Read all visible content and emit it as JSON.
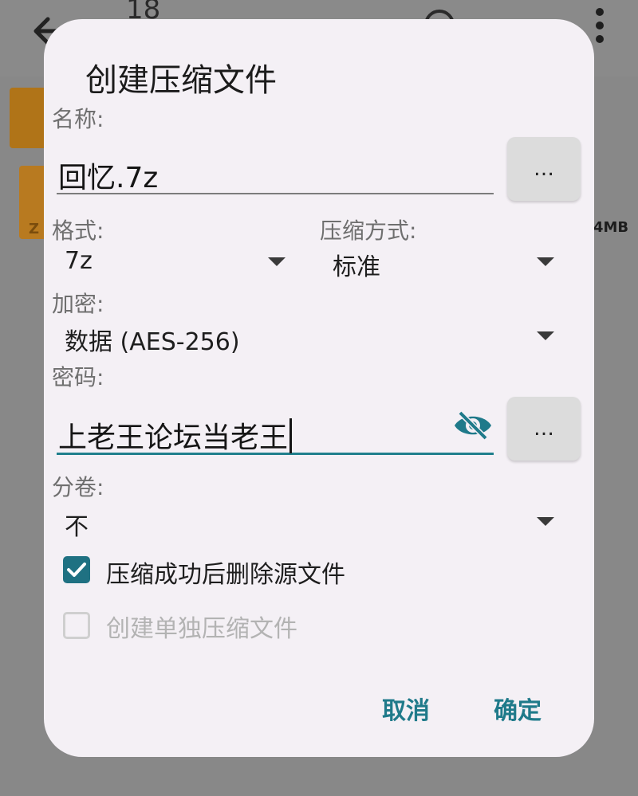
{
  "background": {
    "count_label": "18",
    "file_size": "4MB"
  },
  "dialog": {
    "title": "创建压缩文件",
    "name": {
      "label": "名称:",
      "value": "回忆.7z",
      "browse_label": "..."
    },
    "format": {
      "label": "格式:",
      "value": "7z"
    },
    "compression": {
      "label": "压缩方式:",
      "value": "标准"
    },
    "encryption": {
      "label": "加密:",
      "value": "数据 (AES-256)"
    },
    "password": {
      "label": "密码:",
      "value": "上老王论坛当老王",
      "browse_label": "..."
    },
    "split": {
      "label": "分卷:",
      "value": "不"
    },
    "options": [
      {
        "label": "压缩成功后删除源文件",
        "checked": true,
        "enabled": true
      },
      {
        "label": "创建单独压缩文件",
        "checked": false,
        "enabled": false
      }
    ],
    "buttons": {
      "cancel": "取消",
      "ok": "确定"
    }
  },
  "colors": {
    "accent": "#1f7a8a",
    "dialog_bg": "#f4f0f5",
    "scrim": "#888888"
  }
}
